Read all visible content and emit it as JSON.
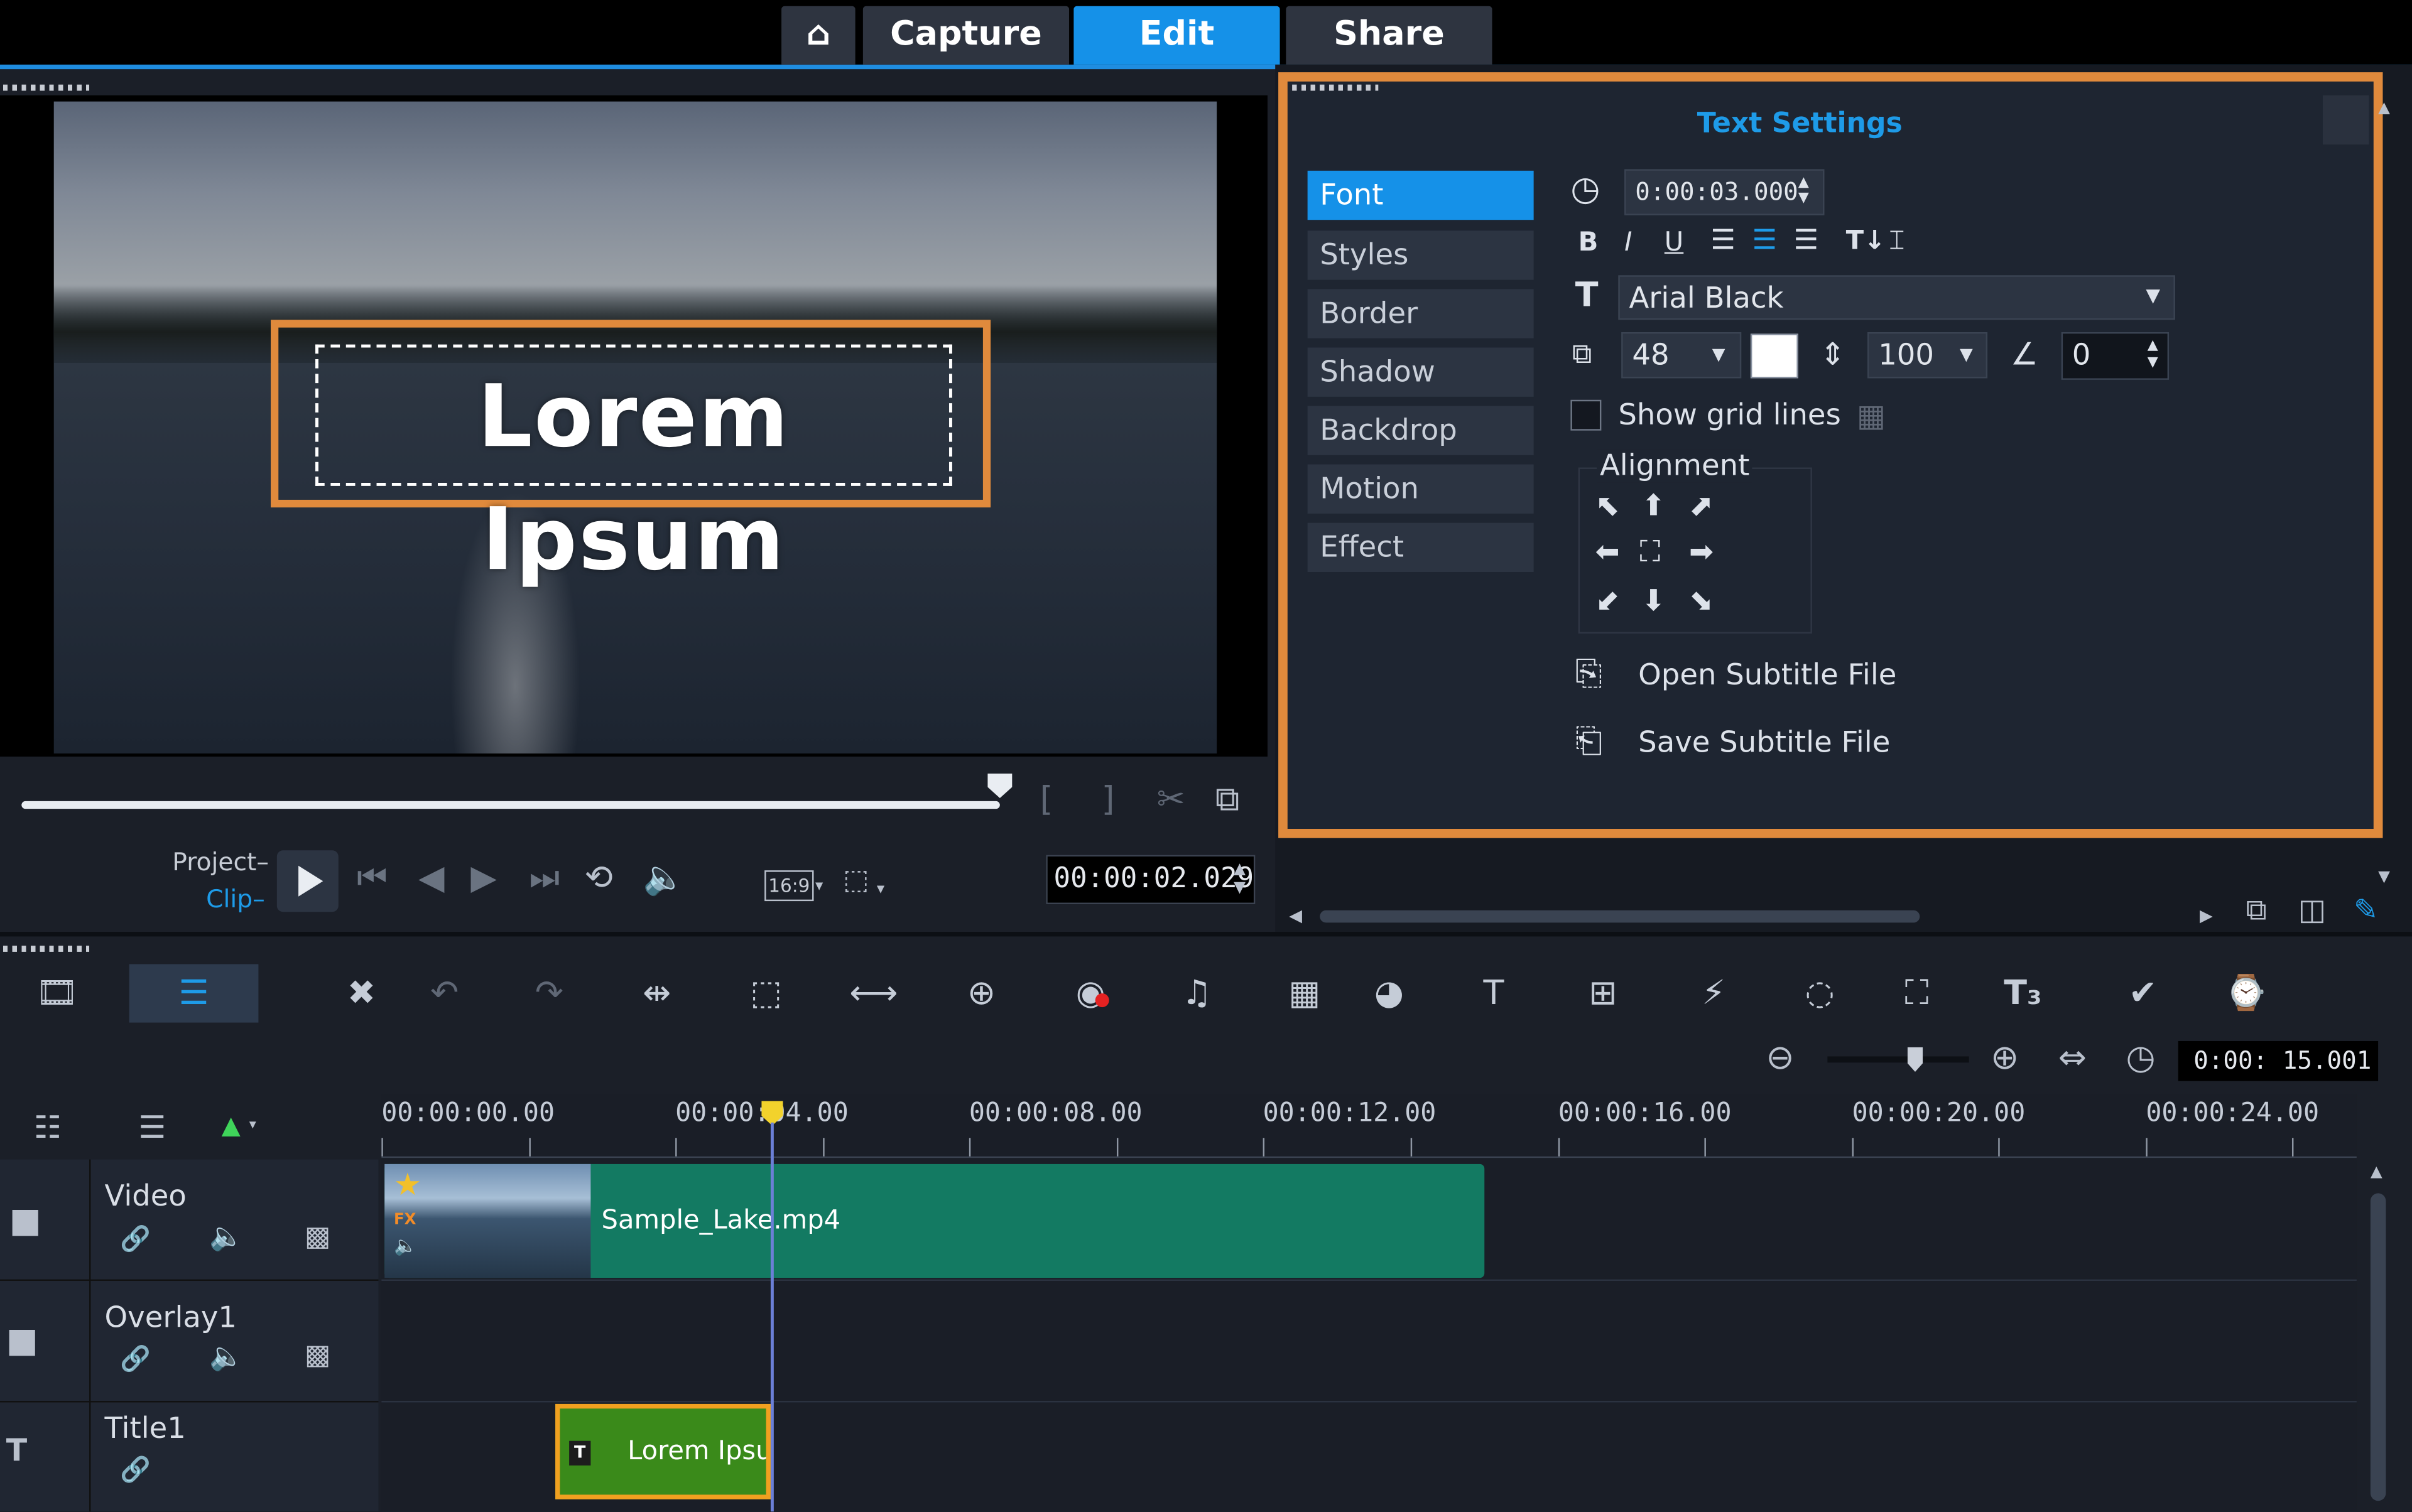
{
  "topnav": {
    "home_icon": "home-icon",
    "tabs": [
      {
        "label": "Capture"
      },
      {
        "label": "Edit"
      },
      {
        "label": "Share"
      }
    ]
  },
  "preview": {
    "title_text": "Lorem Ipsum",
    "mode_project": "Project–",
    "mode_clip": "Clip–",
    "aspect": "16:9",
    "timecode": "00:00:02.029",
    "progress": 0.95
  },
  "text_settings": {
    "title": "Text Settings",
    "side_tabs": [
      "Font",
      "Styles",
      "Border",
      "Shadow",
      "Backdrop",
      "Motion",
      "Effect"
    ],
    "active_tab": "Font",
    "duration": "0:00:03.000",
    "font_name": "Arial Black",
    "font_size": "48",
    "line_spacing": "100",
    "angle": "0",
    "show_grid_lines": "Show grid lines",
    "alignment_label": "Alignment",
    "open_subtitle": "Open Subtitle File",
    "save_subtitle": "Save Subtitle File",
    "font_color": "#ffffff"
  },
  "timeline": {
    "project_duration": "0:00: 15.001",
    "ruler_labels": [
      "00:00:00.00",
      "00:00:04.00",
      "00:00:08.00",
      "00:00:12.00",
      "00:00:16.00",
      "00:00:20.00",
      "00:00:24.00"
    ],
    "tracks": [
      {
        "name": "Video",
        "clip": "Sample_Lake.mp4"
      },
      {
        "name": "Overlay1",
        "clip": ""
      },
      {
        "name": "Title1",
        "clip": "Lorem Ipsu"
      }
    ]
  },
  "colors": {
    "accent": "#1591e8",
    "highlight": "#e08a3c",
    "video_clip": "#137a62",
    "title_clip": "#3a8a1a"
  }
}
